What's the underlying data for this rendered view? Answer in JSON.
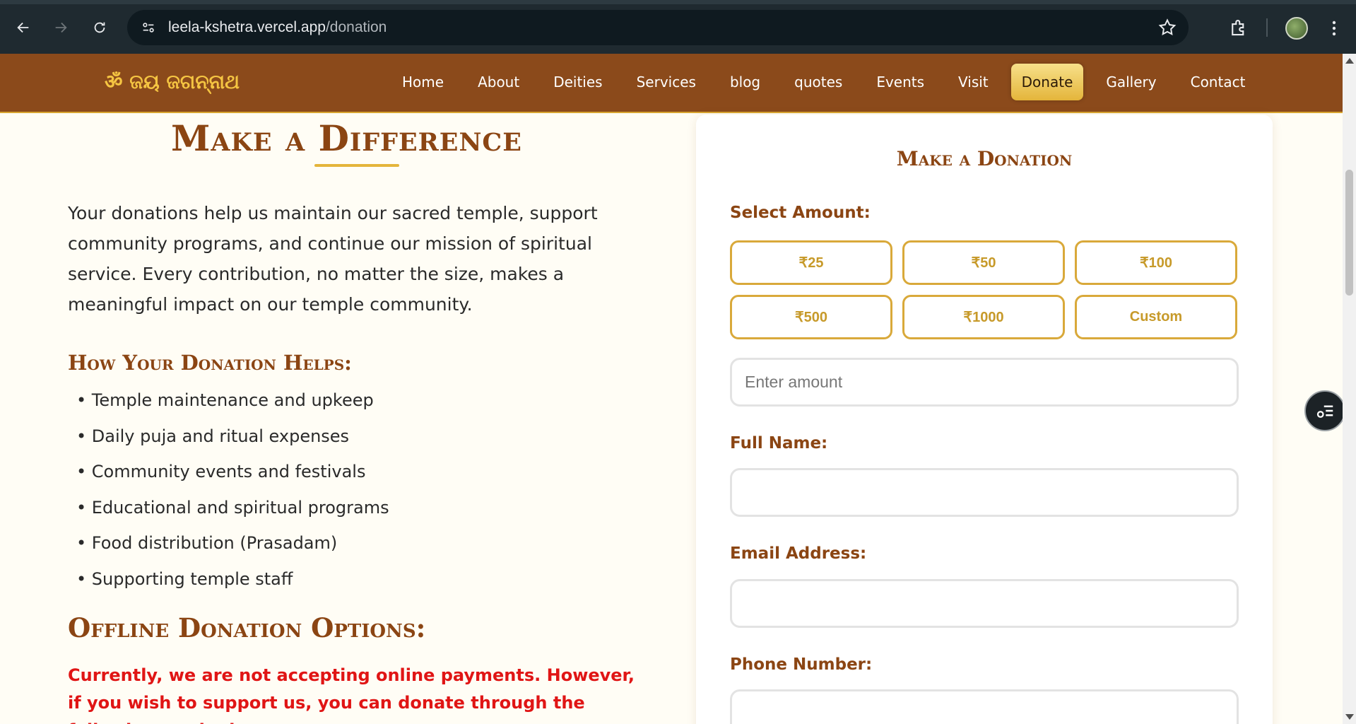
{
  "browser": {
    "url_domain": "leela-kshetra.vercel.app",
    "url_path": "/donation"
  },
  "header": {
    "logo": "ॐ ଜୟ ଜଗନ୍ନାଥ",
    "nav": [
      "Home",
      "About",
      "Deities",
      "Services",
      "blog",
      "quotes",
      "Events",
      "Visit",
      "Donate",
      "Gallery",
      "Contact"
    ],
    "active_nav": "Donate",
    "colors": {
      "background": "#8b4a1b",
      "logo": "#f5c542",
      "accent": "#e4b53b"
    }
  },
  "left": {
    "title": "Make a Difference",
    "intro": "Your donations help us maintain our sacred temple, support community programs, and continue our mission of spiritual service. Every contribution, no matter the size, makes a meaningful impact on our temple community.",
    "helps_heading": "How Your Donation Helps:",
    "helps": [
      "• Temple maintenance and upkeep",
      "• Daily puja and ritual expenses",
      "• Community events and festivals",
      "• Educational and spiritual programs",
      "• Food distribution (Prasadam)",
      "• Supporting temple staff"
    ],
    "offline_heading": "Offline Donation Options:",
    "notice": "Currently, we are not accepting online payments. However, if you wish to support us, you can donate through the following methods:",
    "notice_color": "#e01515"
  },
  "donation_form": {
    "title": "Make a Donation",
    "select_amount_label": "Select Amount:",
    "amounts": [
      "₹25",
      "₹50",
      "₹100",
      "₹500",
      "₹1000",
      "Custom"
    ],
    "amount_placeholder": "Enter amount",
    "full_name_label": "Full Name:",
    "email_label": "Email Address:",
    "phone_label": "Phone Number:"
  }
}
